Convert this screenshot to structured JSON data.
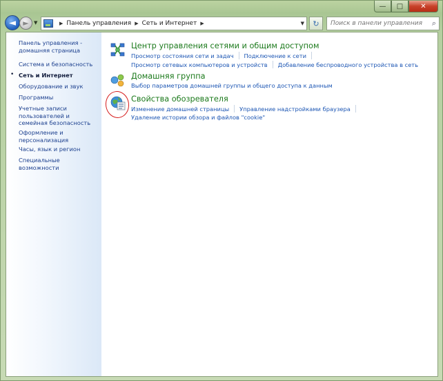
{
  "window": {
    "caption": {
      "minimize": "—",
      "maximize": "□",
      "close": "✕"
    }
  },
  "nav": {
    "back_glyph": "◄",
    "forward_glyph": "►",
    "history_glyph": "▼",
    "breadcrumb": [
      "Панель управления",
      "Сеть и Интернет"
    ],
    "crumb_sep": "▶",
    "address_drop": "▼",
    "refresh_glyph": "↻",
    "search_placeholder": "Поиск в панели управления",
    "search_glyph": "⌕"
  },
  "sidebar": {
    "items": [
      {
        "label": "Панель управления - домашняя страница",
        "active": false
      },
      {
        "label": "Система и безопасность",
        "active": false
      },
      {
        "label": "Сеть и Интернет",
        "active": true
      },
      {
        "label": "Оборудование и звук",
        "active": false
      },
      {
        "label": "Программы",
        "active": false
      },
      {
        "label": "Учетные записи пользователей и семейная безопасность",
        "active": false
      },
      {
        "label": "Оформление и персонализация",
        "active": false
      },
      {
        "label": "Часы, язык и регион",
        "active": false
      },
      {
        "label": "Специальные возможности",
        "active": false
      }
    ],
    "bullet": "•"
  },
  "categories": [
    {
      "title": "Центр управления сетями и общим доступом",
      "icon": "network-center-icon",
      "link_rows": [
        [
          "Просмотр состояния сети и задач",
          "Подключение к сети"
        ],
        [
          "Просмотр сетевых компьютеров и устройств",
          "Добавление беспроводного устройства в сеть"
        ]
      ]
    },
    {
      "title": "Домашняя группа",
      "icon": "homegroup-icon",
      "link_rows": [
        [
          "Выбор параметров домашней группы и общего доступа к данным"
        ]
      ]
    },
    {
      "title": "Свойства обозревателя",
      "icon": "internet-options-icon",
      "link_rows": [
        [
          "Изменение домашней страницы",
          "Управление надстройками браузера"
        ],
        [
          "Удаление истории обзора и файлов \"cookie\""
        ]
      ]
    }
  ],
  "colors": {
    "link": "#1b55b3",
    "category_title": "#1c7a1c",
    "annotation": "#d61a1a"
  }
}
